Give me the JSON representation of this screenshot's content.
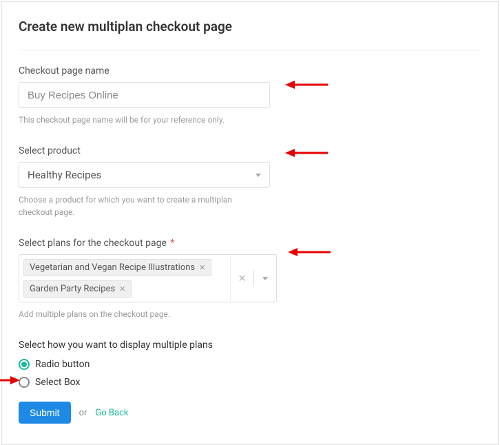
{
  "title": "Create new multiplan checkout page",
  "pageName": {
    "label": "Checkout page name",
    "value": "Buy Recipes Online",
    "helper": "This checkout page name will be for your reference only."
  },
  "product": {
    "label": "Select product",
    "value": "Healthy Recipes",
    "helper": "Choose a product for which you want to create a multiplan checkout page."
  },
  "plans": {
    "label": "Select plans for the checkout page",
    "required": "*",
    "tags": [
      "Vegetarian and Vegan Recipe Illustrations",
      "Garden Party Recipes"
    ],
    "helper": "Add multiple plans on the checkout page."
  },
  "display": {
    "label": "Select how you want to display multiple plans",
    "options": [
      "Radio button",
      "Select Box"
    ],
    "selectedIndex": 0
  },
  "actions": {
    "submit": "Submit",
    "or": "or",
    "goBack": "Go Back"
  }
}
